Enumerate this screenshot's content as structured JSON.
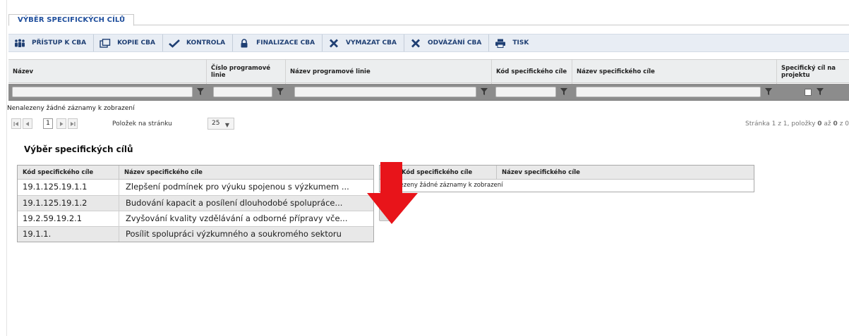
{
  "tab": {
    "label": "VÝBĚR SPECIFICKÝCH CÍLŮ"
  },
  "toolbar": {
    "buttons": [
      {
        "label": "PŘÍSTUP K CBA",
        "icon": "people-icon"
      },
      {
        "label": "KOPIE CBA",
        "icon": "copy-icon"
      },
      {
        "label": "KONTROLA",
        "icon": "checkmark-icon"
      },
      {
        "label": "FINALIZACE CBA",
        "icon": "lock-icon"
      },
      {
        "label": "VYMAZAT CBA",
        "icon": "delete-x-icon"
      },
      {
        "label": "ODVÁZÁNÍ CBA",
        "icon": "unlink-x-icon"
      },
      {
        "label": "TISK",
        "icon": "printer-icon"
      }
    ]
  },
  "grid": {
    "columns": [
      "Název",
      "Číslo programové linie",
      "Název programové linie",
      "Kód specifického cíle",
      "Název specifického cíle",
      "Specifický cíl na projektu"
    ],
    "empty_message": "Nenalezeny žádné záznamy k zobrazení"
  },
  "pager": {
    "current_page": "1",
    "page_size_label": "Položek na stránku",
    "page_size": "25",
    "info_prefix": "Stránka 1 z 1, položky",
    "info_from": "0",
    "info_mid": "až",
    "info_to": "0",
    "info_suffix": "z 0"
  },
  "section": {
    "title": "Výběr specifických cílů"
  },
  "left_table": {
    "headers": [
      "Kód specifického cíle",
      "Název specifického cíle"
    ],
    "rows": [
      {
        "code": "19.1.125.19.1.1",
        "name": "Zlepšení podmínek pro výuku spojenou s výzkumem ..."
      },
      {
        "code": "19.1.125.19.1.2",
        "name": "Budování kapacit a posílení dlouhodobé spolupráce..."
      },
      {
        "code": "19.2.59.19.2.1",
        "name": "Zvyšování kvality vzdělávání a odborné přípravy vče..."
      },
      {
        "code": "19.1.1.",
        "name": "Posílit spolupráci výzkumného a soukromého sektoru"
      }
    ]
  },
  "right_table": {
    "headers": [
      "Kód specifického cíle",
      "Název specifického cíle"
    ],
    "empty_message": "Nenalezeny žádné záznamy k zobrazení"
  },
  "colors": {
    "accent": "#1f4e9c",
    "toolbar_bg": "#e8edf4",
    "filter_bg": "#8c8c8c",
    "arrow": "#e8141a"
  }
}
